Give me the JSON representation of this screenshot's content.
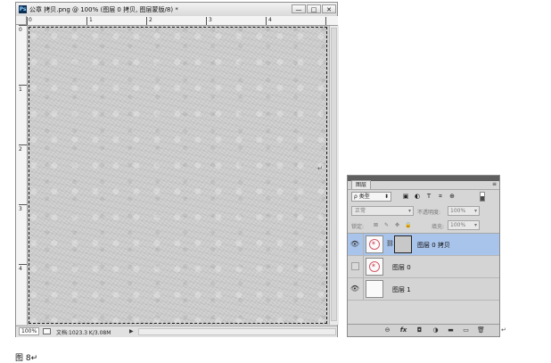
{
  "document": {
    "app_badge": "Ps",
    "title": "公章 拷贝.png @ 100% (图层 0 拷贝, 图层蒙版/8) *",
    "buttons": {
      "minimize": "—",
      "maximize": "□",
      "close": "✕"
    },
    "ruler_top_labels": [
      "0",
      "1",
      "2",
      "3",
      "4"
    ],
    "ruler_left_labels": [
      "0",
      "1",
      "2",
      "3",
      "4"
    ],
    "status": {
      "zoom": "100%",
      "doc_info": "文档:1023.3 K/3.08M",
      "arrow": "▶"
    }
  },
  "layers_panel": {
    "tab_label": "图层",
    "menu_icon": "≡",
    "filter": {
      "label": "ρ 类型",
      "arrow": "⬍"
    },
    "filter_icons": [
      "image-filter-icon",
      "adjustment-filter-icon",
      "text-filter-icon",
      "shape-filter-icon",
      "smart-object-filter-icon"
    ],
    "filter_glyphs": [
      "▣",
      "◐",
      "T",
      "⌗",
      "⊕"
    ],
    "blend_mode": "正常",
    "opacity_label": "不透明度:",
    "opacity_value": "100%",
    "lock_label": "锁定:",
    "lock_glyphs": [
      "⊠",
      "✎",
      "✥",
      "🔒"
    ],
    "fill_label": "填充:",
    "fill_value": "100%",
    "dropdown_arrow": "▾",
    "layers": [
      {
        "name": "图层 0 拷贝",
        "visible": true,
        "selected": true,
        "has_mask": true
      },
      {
        "name": "图层 0",
        "visible": false,
        "selected": false,
        "has_mask": false
      },
      {
        "name": "图层 1",
        "visible": true,
        "selected": false,
        "has_mask": false
      }
    ],
    "eye_glyph": "👁",
    "chain_glyph": "⛓",
    "seal_glyph": "✶",
    "bottom_glyphs": [
      "⊖",
      "fx",
      "◘",
      "◑",
      "▬",
      "▭",
      "🗑"
    ],
    "bottom_icons": [
      "link-layers-icon",
      "fx-icon",
      "add-mask-icon",
      "new-adjustment-icon",
      "new-group-icon",
      "new-layer-icon",
      "delete-layer-icon"
    ]
  },
  "return_mark": "↵",
  "caption": "图 8↵"
}
